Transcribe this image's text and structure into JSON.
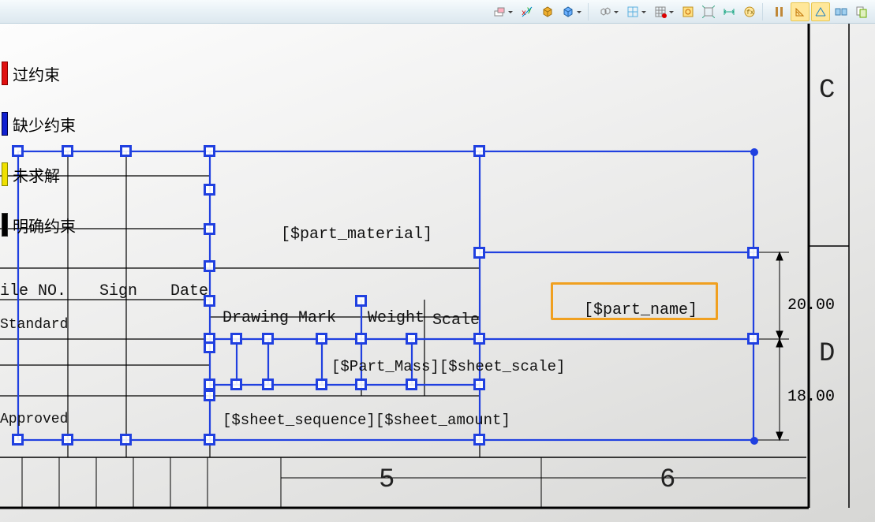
{
  "toolbar": {
    "eraser": "eraser",
    "xy": "xy-coords",
    "cube1": "cube-gold",
    "cube2": "cube-blue",
    "cubes_dd": "cubes-dropdown",
    "grid_blue": "grid-layout",
    "grid_red": "grid-layout-red",
    "axis_box": "axis-box",
    "arrows_out": "expand-arrows",
    "dim_h": "horizontal-dim",
    "fx": "fx-button",
    "bars": "bars-indicator",
    "angle": "angle-tool",
    "angle2": "angle-highlight",
    "views": "views",
    "sheet": "sheet-switch"
  },
  "legend": {
    "over": {
      "label": "过约束",
      "color": "#e01010"
    },
    "under": {
      "label": "缺少约束",
      "color": "#1020d0"
    },
    "unsolved": {
      "label": "未求解",
      "color": "#f0e000"
    },
    "defined": {
      "label": "明确约束",
      "color": "#000000"
    }
  },
  "frame": {
    "col5": "5",
    "col6": "6",
    "rowC": "C",
    "rowD": "D"
  },
  "cells": {
    "file_no": "ile NO.",
    "sign": "Sign",
    "date": "Date",
    "standard": "Standard",
    "approved": "Approved",
    "drawing_mark": "Drawing Mark",
    "weight": "Weight",
    "scale": "Scale",
    "part_material": "[$part_material]",
    "part_mass_scale": "[$Part_Mass][$sheet_scale]",
    "sheet_seq": "[$sheet_sequence][$sheet_amount]",
    "part_name": "[$part_name]"
  },
  "dims": {
    "d20": "20.00",
    "d18": "18.00"
  }
}
